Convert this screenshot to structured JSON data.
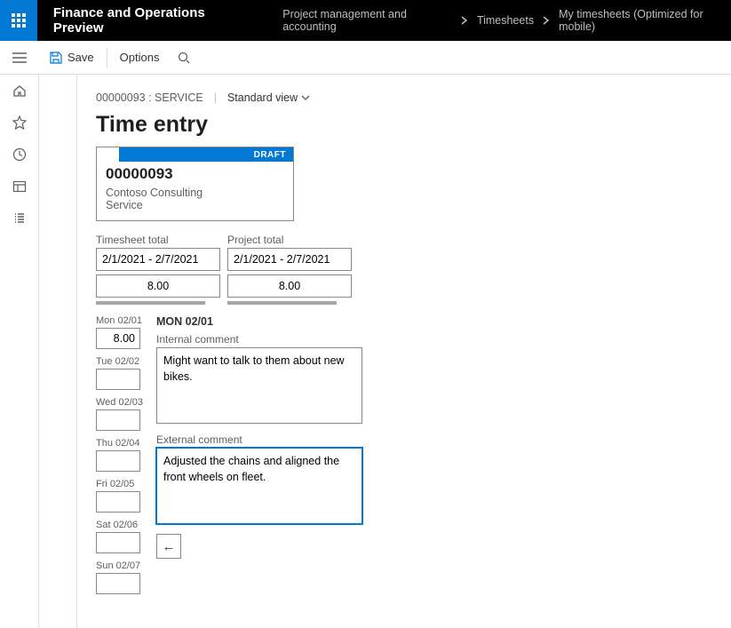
{
  "header": {
    "app_title": "Finance and Operations Preview",
    "breadcrumb": {
      "a": "Project management and accounting",
      "b": "Timesheets",
      "c": "My timesheets (Optimized for mobile)"
    }
  },
  "toolbar": {
    "save_label": "Save",
    "options_label": "Options"
  },
  "subheader": {
    "id_label": "00000093 : SERVICE",
    "view_label": "Standard view"
  },
  "page_title": "Time entry",
  "card": {
    "status": "DRAFT",
    "doc_id": "00000093",
    "customer": "Contoso Consulting",
    "service": "Service"
  },
  "totals": {
    "timesheet_label": "Timesheet total",
    "project_label": "Project total",
    "timesheet_range": "2/1/2021 - 2/7/2021",
    "project_range": "2/1/2021 - 2/7/2021",
    "timesheet_sum": "8.00",
    "project_sum": "8.00"
  },
  "days": {
    "mon": {
      "label": "Mon 02/01",
      "value": "8.00"
    },
    "tue": {
      "label": "Tue 02/02",
      "value": ""
    },
    "wed": {
      "label": "Wed 02/03",
      "value": ""
    },
    "thu": {
      "label": "Thu 02/04",
      "value": ""
    },
    "fri": {
      "label": "Fri 02/05",
      "value": ""
    },
    "sat": {
      "label": "Sat 02/06",
      "value": ""
    },
    "sun": {
      "label": "Sun 02/07",
      "value": ""
    }
  },
  "detail": {
    "header": "MON 02/01",
    "internal_label": "Internal comment",
    "internal_value": "Might want to talk to them about new bikes.",
    "external_label": "External comment",
    "external_value": "Adjusted the chains and aligned the front wheels on fleet."
  },
  "icons": {
    "back_arrow": "←"
  }
}
